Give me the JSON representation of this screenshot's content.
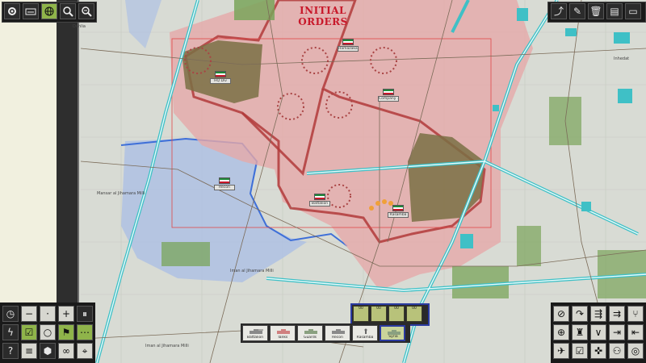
{
  "header": {
    "title": "INITIAL ORDERS"
  },
  "map_labels": [
    {
      "text": "Dahlia"
    },
    {
      "text": "Inhedat"
    },
    {
      "text": "Mansar al Jihamara Milli"
    },
    {
      "text": "Iman al Jihamara Milli"
    },
    {
      "text": "Iman al Jihamara Milli"
    }
  ],
  "units": [
    {
      "label": "HQ Div"
    },
    {
      "label": "Hamazaka 2"
    },
    {
      "label": "Company 1"
    },
    {
      "label": "Recon"
    },
    {
      "label": "Battalion"
    },
    {
      "label": "Rasamba"
    }
  ],
  "unit_cards": [
    {
      "label": "Battalion"
    },
    {
      "label": "Tanks"
    },
    {
      "label": "Guards"
    },
    {
      "label": "Recon"
    },
    {
      "label": "Rasamba"
    },
    {
      "label": "Syria"
    }
  ],
  "order_slots": [
    {
      "label": "00"
    },
    {
      "label": "00"
    },
    {
      "label": "00"
    },
    {
      "label": "00"
    }
  ],
  "icons": {
    "top_left": [
      "gear-icon",
      "keyboard-icon",
      "globe-icon",
      "zoom-out-icon",
      "zoom-in-icon"
    ],
    "top_right": [
      "curve-tool-icon",
      "pen-icon",
      "trash-icon",
      "note-icon"
    ],
    "bottom_left": [
      "clock-icon",
      "minus-icon",
      "dots-icon",
      "plus-icon",
      "pause-icon",
      "flash-icon",
      "checkbox-icon",
      "circle-icon",
      "flag-icon",
      "dots-line-icon",
      "help-icon",
      "list-icon",
      "hex-icon",
      "binoculars-icon"
    ],
    "bottom_right": [
      "no-entry-icon",
      "curve-arrow-icon",
      "split-arrow-icon",
      "multi-arrow-icon",
      "fork-icon",
      "crosshair-icon",
      "unit-icon",
      "chevron-icon",
      "enter-icon",
      "exit-icon",
      "move-icon",
      "check-all-icon",
      "vehicles-icon",
      "soldier-icon",
      "target-icon"
    ]
  },
  "colors": {
    "enemy_area": "#e6a9a9",
    "friendly_area": "#a9bde6",
    "road": "#3fc0c6",
    "panel": "#1a1a1a",
    "accent_green": "#8fb44a",
    "title_red": "#c8182a"
  }
}
